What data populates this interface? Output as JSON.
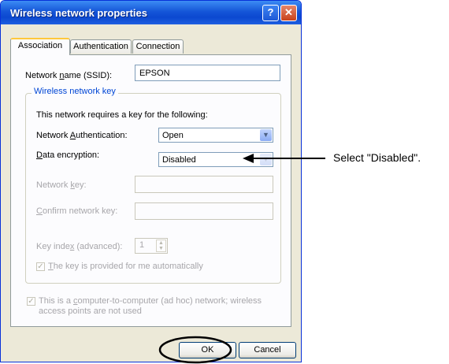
{
  "window": {
    "title": "Wireless network properties",
    "help_glyph": "?",
    "close_glyph": "✕"
  },
  "tabs": [
    {
      "label": "Association",
      "active": true
    },
    {
      "label": "Authentication",
      "active": false
    },
    {
      "label": "Connection",
      "active": false
    }
  ],
  "ssid": {
    "label_pre": "Network ",
    "label_key": "n",
    "label_post": "ame (SSID):",
    "value": "EPSON"
  },
  "key_group": {
    "title": "Wireless network key",
    "description": "This network requires a key for the following:",
    "auth_label_pre": "Network ",
    "auth_label_key": "A",
    "auth_label_post": "uthentication:",
    "auth_value": "Open",
    "enc_label_key": "D",
    "enc_label_post": "ata encryption:",
    "enc_value": "Disabled",
    "net_key_label_pre": "Network ",
    "net_key_label_key": "k",
    "net_key_label_post": "ey:",
    "confirm_label_key": "C",
    "confirm_label_post": "onfirm network key:",
    "index_label_pre": "Key inde",
    "index_label_key": "x",
    "index_label_post": " (advanced):",
    "index_value": "1",
    "auto_key_pre": "T",
    "auto_key_post": "he key is provided for me automatically",
    "auto_key_checked": true
  },
  "adhoc": {
    "line1_pre": "This is a ",
    "line1_key": "c",
    "line1_post": "omputer-to-computer (ad hoc) network; wireless",
    "line2": "access points are not used",
    "checked": true
  },
  "buttons": {
    "ok": "OK",
    "cancel": "Cancel"
  },
  "annotation": {
    "text": "Select \"Disabled\"."
  },
  "icons": {
    "dropdown": "chevron-down-icon",
    "check": "checkmark-icon"
  }
}
